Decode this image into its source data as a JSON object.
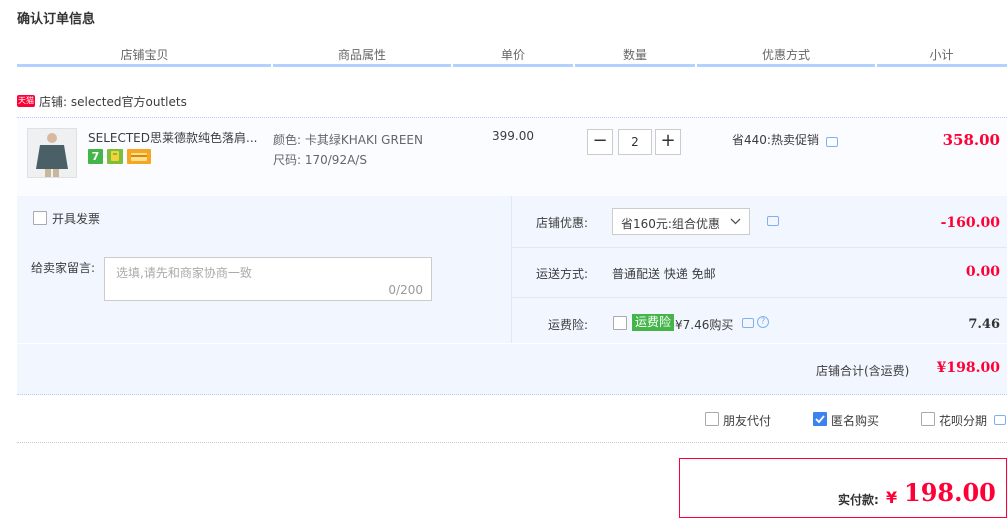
{
  "page_title": "确认订单信息",
  "columns": [
    "店铺宝贝",
    "商品属性",
    "单价",
    "数量",
    "优惠方式",
    "小计"
  ],
  "shop": {
    "tag": "天猫",
    "name": "店铺: selected官方outlets"
  },
  "item": {
    "title": "SELECTED思莱德款纯色落肩...",
    "color": "颜色: 卡其绿KHAKI GREEN",
    "size": "尺码: 170/92A/S",
    "price": "399.00",
    "quantity": "2",
    "minus": "−",
    "plus": "+",
    "promo": "省440:热卖促销",
    "subtotal": "358.00",
    "badge_number": "7"
  },
  "options": {
    "invoice_label": "开具发票",
    "message_label": "给卖家留言:",
    "message_placeholder": "选填,请先和商家协商一致",
    "message_count": "0/200",
    "store_discount_label": "店铺优惠:",
    "store_discount_value": "省160元:组合优惠",
    "store_discount_amount": "-160.00",
    "shipping_label": "运送方式:",
    "shipping_value": "普通配送 快递 免邮",
    "shipping_amount": "0.00",
    "insurance_label": "运费险:",
    "insurance_tag": "运费险",
    "insurance_text": "¥7.46购买",
    "insurance_amount": "7.46"
  },
  "total": {
    "label": "店铺合计(含运费)",
    "amount": "¥198.00"
  },
  "pay_options": {
    "friend_pay": "朋友代付",
    "anonymous": "匿名购买",
    "huabei": "花呗分期",
    "anonymous_checked": true
  },
  "final": {
    "label": "实付款:",
    "currency": "¥",
    "amount": "198.00"
  },
  "colors": {
    "accent_red": "#ff0036",
    "header_line": "#b2d1ff",
    "panel_bg": "#f2f7ff",
    "green_tag": "#44b549"
  }
}
